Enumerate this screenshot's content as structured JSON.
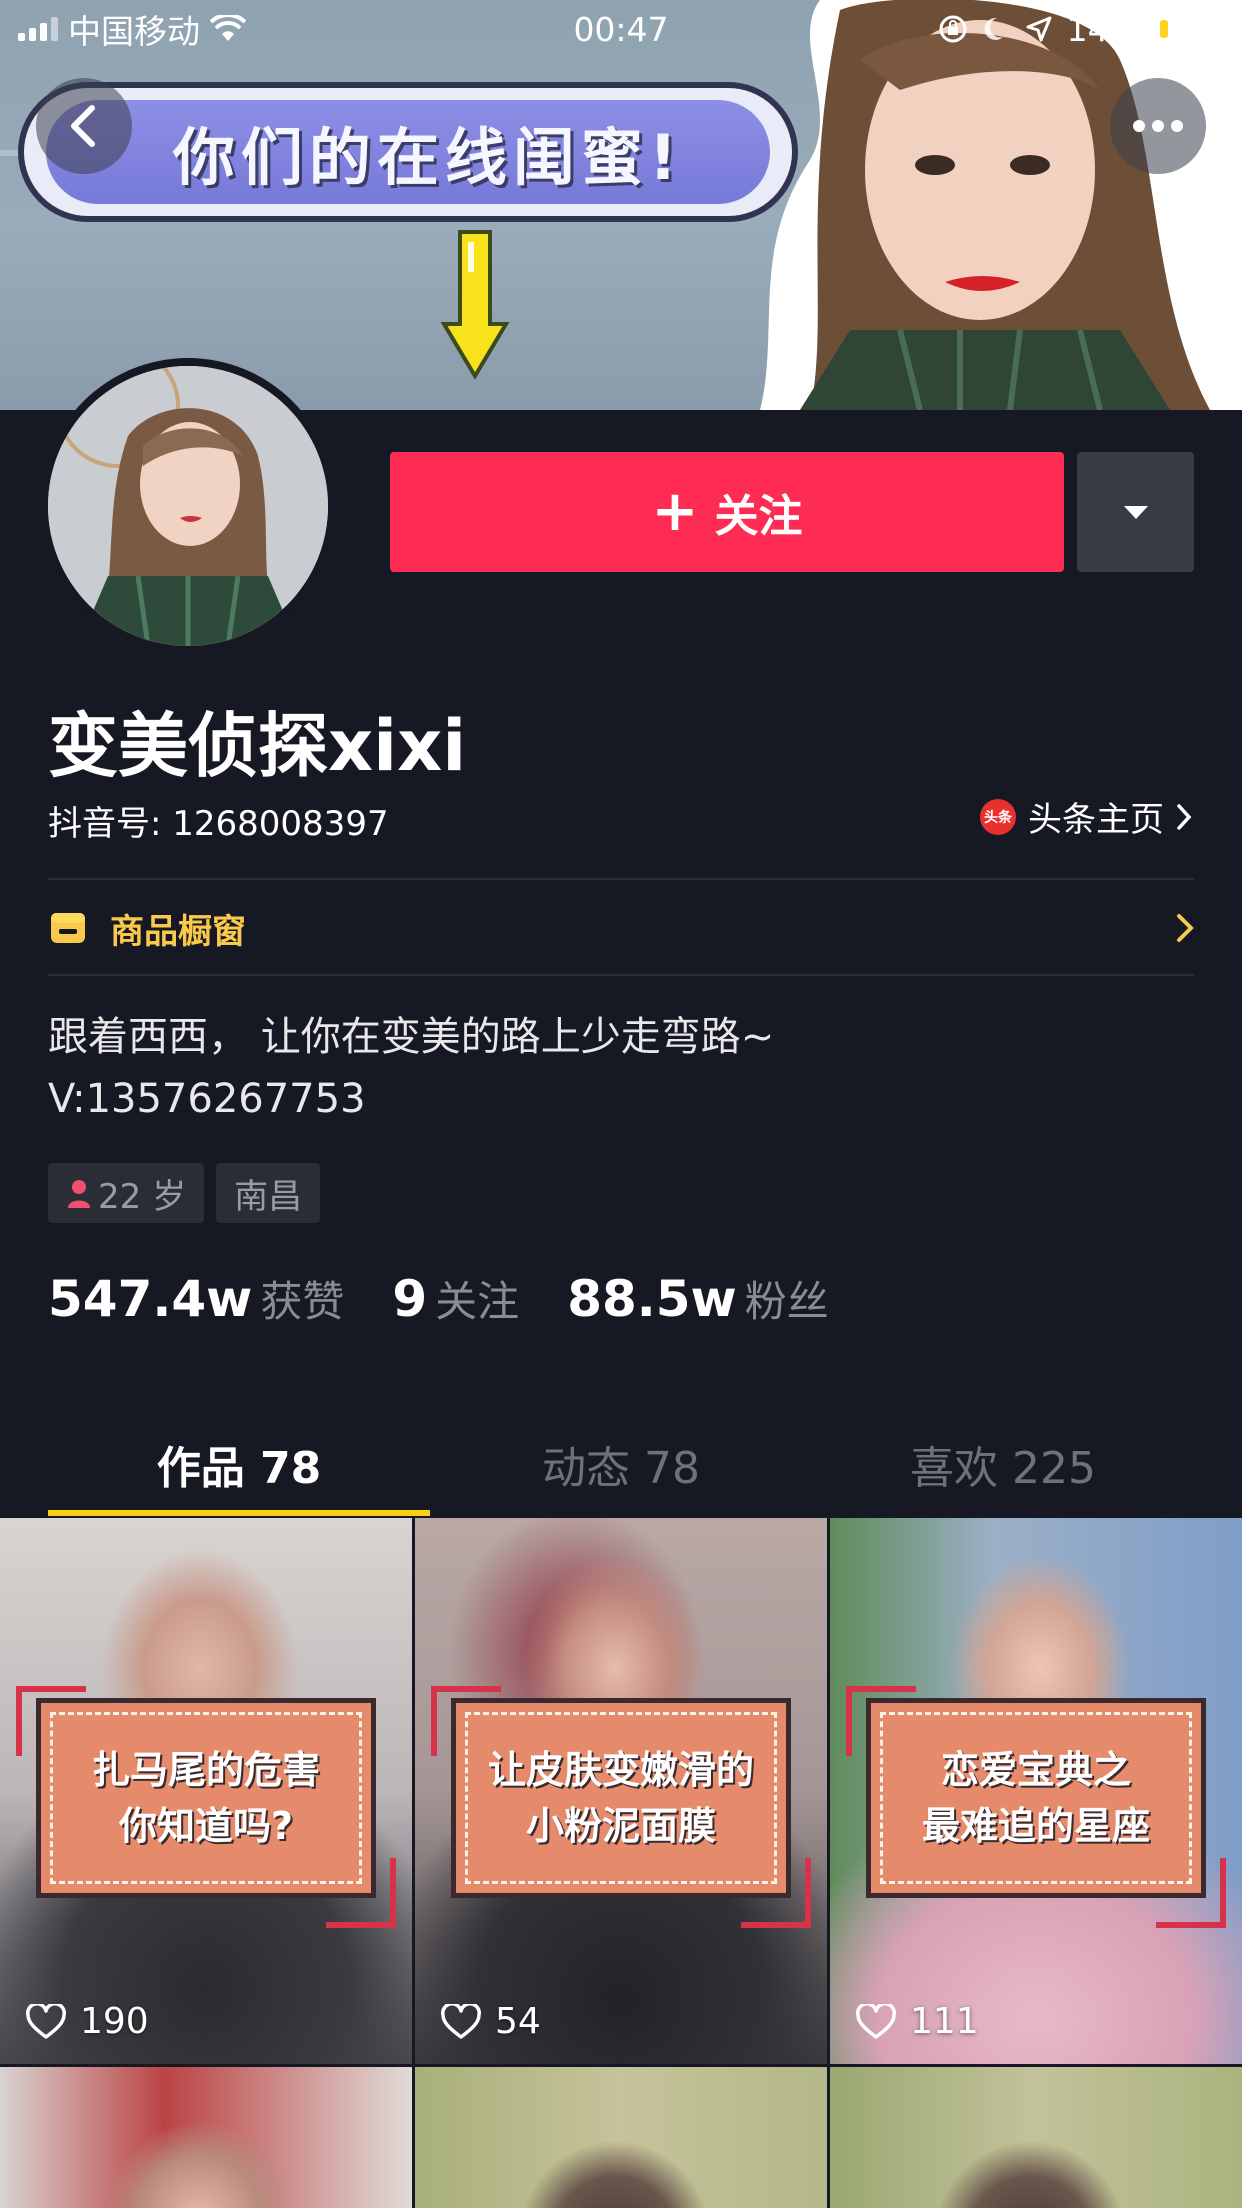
{
  "status_bar": {
    "carrier": "中国移动",
    "time": "00:47",
    "battery_percent": "14%",
    "battery_level": 0.14,
    "battery_color": "#ffd21f"
  },
  "banner": {
    "bubble_text": "你们的在线闺蜜!"
  },
  "header": {
    "back_icon": "chevron-left-icon",
    "more_icon": "more-dots-icon"
  },
  "actions": {
    "follow_plus": "+",
    "follow_label": "关注",
    "follow_color": "#fe2c55",
    "dropdown_icon": "triangle-down-icon"
  },
  "profile": {
    "nickname": "变美侦探xixi",
    "douyin_id": "抖音号: 1268008397",
    "toutiao_badge": "头条",
    "toutiao_label": "头条主页",
    "shop_label": "商品橱窗",
    "bio_line1": "跟着西西， 让你在变美的路上少走弯路~",
    "bio_line2": "V:13576267753",
    "tags": [
      {
        "icon": "female-icon",
        "label": "22 岁"
      },
      {
        "label": "南昌"
      }
    ]
  },
  "stats": [
    {
      "num": "547.4w",
      "label": "获赞"
    },
    {
      "num": "9",
      "label": "关注"
    },
    {
      "num": "88.5w",
      "label": "粉丝"
    }
  ],
  "tabs": [
    {
      "label": "作品 78",
      "active": true
    },
    {
      "label": "动态 78",
      "active": false
    },
    {
      "label": "喜欢 225",
      "active": false
    }
  ],
  "videos": [
    {
      "title_line1": "扎马尾的危害",
      "title_line2": "你知道吗?",
      "likes": "190"
    },
    {
      "title_line1": "让皮肤变嫩滑的",
      "title_line2": "小粉泥面膜",
      "likes": "54"
    },
    {
      "title_line1": "恋爱宝典之",
      "title_line2": "最难追的星座",
      "likes": "111"
    }
  ],
  "accent_colors": {
    "tab_indicator": "#face15",
    "shop": "#f8c94a",
    "background": "#161823"
  }
}
